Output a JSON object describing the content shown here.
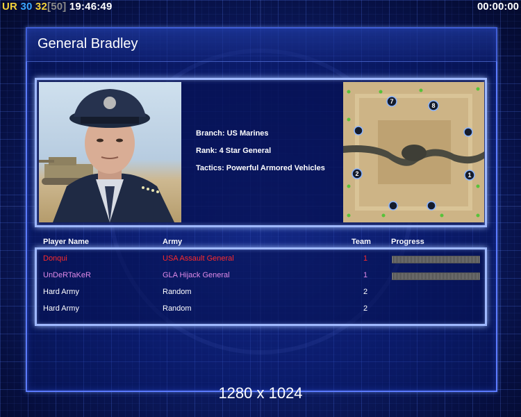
{
  "hud": {
    "ur_label": "UR",
    "ur_value": "30",
    "unit_count": "32",
    "unit_cap": "[50]",
    "clock": "19:46:49",
    "timer": "00:00:00"
  },
  "general": {
    "name": "General Bradley",
    "branch": "Branch: US Marines",
    "rank": "Rank: 4 Star General",
    "tactics": "Tactics: Powerful Armored Vehicles"
  },
  "minimap": {
    "start_positions": [
      "7",
      "8",
      "2",
      "1"
    ]
  },
  "players_table": {
    "headers": {
      "name": "Player Name",
      "army": "Army",
      "team": "Team",
      "progress": "Progress"
    },
    "rows": [
      {
        "name": "Donqui",
        "army": "USA Assault General",
        "team": "1",
        "color": "#ff2a2a",
        "has_progress": true
      },
      {
        "name": "UnDeRTaKeR",
        "army": "GLA Hijack General",
        "team": "1",
        "color": "#e08ae8",
        "has_progress": true
      },
      {
        "name": "Hard Army",
        "army": "Random",
        "team": "2",
        "color": "#ffffff",
        "has_progress": false
      },
      {
        "name": "Hard Army",
        "army": "Random",
        "team": "2",
        "color": "#ffffff",
        "has_progress": false
      }
    ]
  },
  "resolution": "1280 x 1024"
}
